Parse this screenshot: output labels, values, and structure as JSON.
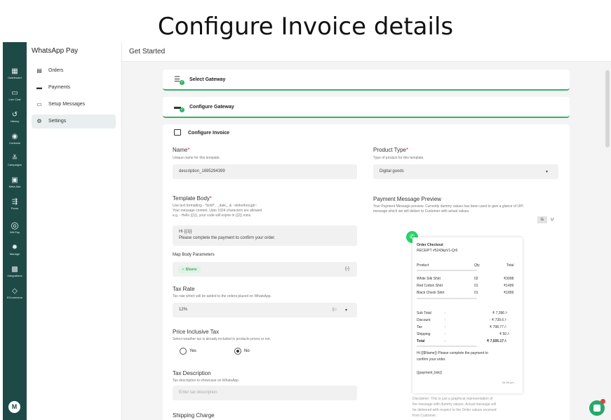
{
  "heading": "Configure Invoice details",
  "rail": {
    "items": [
      {
        "label": "Dashboard",
        "icon": "dashboard-icon",
        "glyph": "▦"
      },
      {
        "label": "Live Chat",
        "icon": "chat-icon",
        "glyph": "▭"
      },
      {
        "label": "History",
        "icon": "history-icon",
        "glyph": "↺"
      },
      {
        "label": "Contacts",
        "icon": "contacts-icon",
        "glyph": "◉"
      },
      {
        "label": "Campaigns",
        "icon": "campaigns-icon",
        "glyph": "≚"
      },
      {
        "label": "Meta Ads",
        "icon": "meta-ads-icon",
        "glyph": "▣"
      },
      {
        "label": "Flows",
        "icon": "flows-icon",
        "glyph": "⇶"
      },
      {
        "label": "WA Pay",
        "icon": "wa-pay-icon",
        "glyph": "◎"
      },
      {
        "label": "Manage",
        "icon": "manage-icon",
        "glyph": "✹"
      },
      {
        "label": "Integrations",
        "icon": "integrations-icon",
        "glyph": "▩"
      },
      {
        "label": "ECommerce",
        "icon": "ecommerce-icon",
        "glyph": "◇"
      }
    ],
    "avatar": "M"
  },
  "sidebar": {
    "brand": "WhatsApp Pay",
    "items": [
      {
        "label": "Orders",
        "icon": "orders-icon",
        "glyph": "▤"
      },
      {
        "label": "Payments",
        "icon": "payments-icon",
        "glyph": "▬"
      },
      {
        "label": "Setup Messages",
        "icon": "messages-icon",
        "glyph": "▭"
      },
      {
        "label": "Settings",
        "icon": "settings-icon",
        "glyph": "⚙",
        "active": true
      }
    ]
  },
  "topbar": {
    "title": "Get Started"
  },
  "steps": [
    {
      "label": "Select Gateway"
    },
    {
      "label": "Configure Gateway"
    }
  ],
  "invoice": {
    "title": "Configure Invoice",
    "name": {
      "label": "Name",
      "required": "*",
      "help": "Unique name for this template.",
      "value": "description_1695294399"
    },
    "product_type": {
      "label": "Product Type",
      "required": "*",
      "help": "Type of product for this template.",
      "value": "Digital goods"
    },
    "template_body": {
      "label": "Template Body",
      "required": "*",
      "help_lines": [
        "Use text formatting - *bold* , _italic_ & ~strikethrough~",
        "Your message content. Upto 1024 characters are allowed.",
        "e.g. - Hello {{1}}, your code will expire in {{2}} mins."
      ],
      "value_lines": [
        "Hi {{1}}",
        "Please complete the payment to confirm your order."
      ]
    },
    "map_params": {
      "label": "Map Body Parameters",
      "chip": "✓ $Name",
      "action": "{-}"
    },
    "tax_rate": {
      "label": "Tax Rate",
      "help": "Tax rate which will be added to the orders placed on WhatsApp.",
      "value": "12%"
    },
    "price_inclusive": {
      "label": "Price Inclusive Tax",
      "help": "Select weather tax is already included in products prices or not.",
      "options": [
        "Yes",
        "No"
      ],
      "selected": "No"
    },
    "tax_description": {
      "label": "Tax Description",
      "help": "Tax description to showcase on WhatsApp",
      "placeholder": "Enter tax description"
    },
    "shipping": {
      "label": "Shipping Charge"
    }
  },
  "preview": {
    "label": "Payment Message Preview",
    "help_lines": [
      "Your Payment Message preview. Currently dummy values has been used to give a glance of UPI",
      "message which we will deliver to Customer with actual values."
    ],
    "toggle": [
      "G",
      "U"
    ],
    "order_title": "Order Checkout",
    "receipt": "RECEIPT #5243kpV1-Qr5",
    "columns": [
      "Product",
      "Qty",
      "Total"
    ],
    "separator": "==========================================",
    "rows": [
      {
        "product": "White Silk Shirt",
        "qty": "02",
        "total": "₹3998"
      },
      {
        "product": "Red Cotton Shirt",
        "qty": "01",
        "total": "₹1499"
      },
      {
        "product": "Black Check Shirt",
        "qty": "01",
        "total": "₹1899"
      }
    ],
    "totals": [
      {
        "label": "Sub Total",
        "colon": ":",
        "value": "₹ 7,396 /-"
      },
      {
        "label": "Discount",
        "colon": ":",
        "value": "- ₹ 739.6 /-"
      },
      {
        "label": "Tax",
        "colon": ":",
        "value": "₹ 798.77 /-"
      },
      {
        "label": "Shipping",
        "colon": ":",
        "value": "₹ 50 /-"
      },
      {
        "label": "Total",
        "colon": ":",
        "value": "₹ 7,505.17 /-"
      }
    ],
    "message_lines": [
      "Hi {{$Name}} Please complete the payment to",
      "confirm your order."
    ],
    "payment_link": "{{payment_link}}",
    "time": "04:39 pm",
    "disclaimer_lines": [
      "Disclaimer: This is just a graphical representation of",
      "the message with dummy values. Actual message will",
      "be delivered with respect to the Order values received",
      "from Customer."
    ]
  },
  "colors": {
    "accent": "#33b36b",
    "rail": "#1d4a47",
    "whatsapp": "#25d366"
  }
}
